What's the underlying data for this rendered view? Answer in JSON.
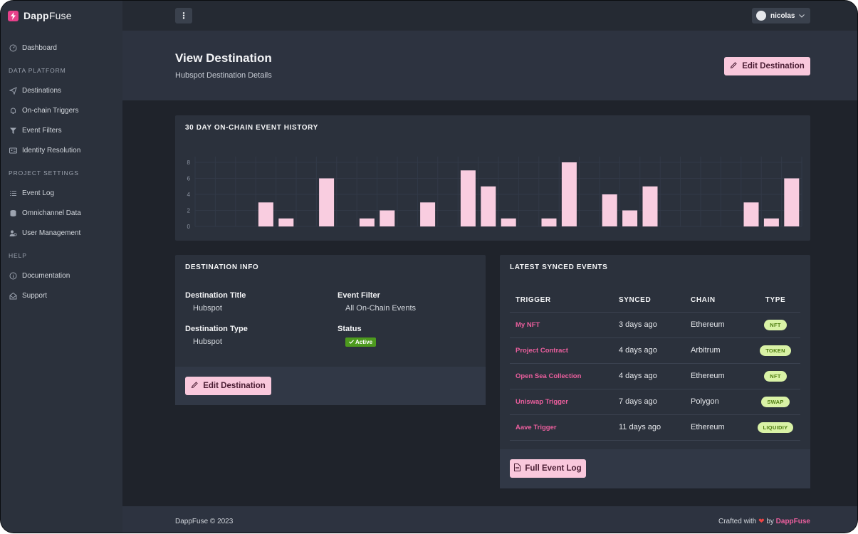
{
  "brand": {
    "name_bold": "Dapp",
    "name_light": "Fuse"
  },
  "sidebar": {
    "dashboard": {
      "label": "Dashboard",
      "icon": "gauge-icon"
    },
    "sections": [
      {
        "title": "DATA PLATFORM",
        "items": [
          {
            "label": "Destinations",
            "icon": "send-icon"
          },
          {
            "label": "On-chain Triggers",
            "icon": "bell-icon"
          },
          {
            "label": "Event Filters",
            "icon": "funnel-icon"
          },
          {
            "label": "Identity Resolution",
            "icon": "id-card-icon"
          }
        ]
      },
      {
        "title": "PROJECT SETTINGS",
        "items": [
          {
            "label": "Event Log",
            "icon": "list-icon"
          },
          {
            "label": "Omnichannel Data",
            "icon": "database-icon"
          },
          {
            "label": "User Management",
            "icon": "users-icon"
          }
        ]
      },
      {
        "title": "HELP",
        "items": [
          {
            "label": "Documentation",
            "icon": "info-icon"
          },
          {
            "label": "Support",
            "icon": "support-icon"
          }
        ]
      }
    ]
  },
  "topbar": {
    "menu_glyph": "⋮",
    "user": "nicolas"
  },
  "header": {
    "title": "View Destination",
    "subtitle": "Hubspot Destination Details",
    "edit_button": "Edit Destination"
  },
  "chart_card": {
    "title": "30 DAY ON-CHAIN EVENT HISTORY"
  },
  "chart_data": {
    "type": "bar",
    "title": "30 DAY ON-CHAIN EVENT HISTORY",
    "values": [
      0,
      0,
      0,
      3,
      1,
      0,
      6,
      0,
      1,
      2,
      0,
      3,
      0,
      7,
      5,
      1,
      0,
      1,
      8,
      0,
      4,
      2,
      5,
      0,
      0,
      0,
      0,
      3,
      1,
      6
    ],
    "ylim": [
      0,
      8
    ],
    "yticks": [
      0,
      2,
      4,
      6,
      8
    ],
    "grid": true,
    "color": "#f9cde0"
  },
  "destination_info": {
    "title": "DESTINATION INFO",
    "dest_title_label": "Destination Title",
    "dest_title_value": "Hubspot",
    "event_filter_label": "Event Filter",
    "event_filter_value": "All On-Chain Events",
    "dest_type_label": "Destination Type",
    "dest_type_value": "Hubspot",
    "status_label": "Status",
    "status_value": "Active",
    "edit_button": "Edit Destination"
  },
  "latest_events": {
    "title": "LATEST SYNCED EVENTS",
    "columns": [
      "TRIGGER",
      "SYNCED",
      "CHAIN",
      "TYPE"
    ],
    "rows": [
      {
        "trigger": "My NFT",
        "synced": "3 days ago",
        "chain": "Ethereum",
        "type": "NFT"
      },
      {
        "trigger": "Project Contract",
        "synced": "4 days ago",
        "chain": "Arbitrum",
        "type": "TOKEN"
      },
      {
        "trigger": "Open Sea Collection",
        "synced": "4 days ago",
        "chain": "Ethereum",
        "type": "NFT"
      },
      {
        "trigger": "Uniswap Trigger",
        "synced": "7 days ago",
        "chain": "Polygon",
        "type": "SWAP"
      },
      {
        "trigger": "Aave Trigger",
        "synced": "11 days ago",
        "chain": "Ethereum",
        "type": "LIQUIDIY"
      }
    ],
    "full_log_button": "Full Event Log"
  },
  "footer": {
    "copyright": "DappFuse © 2023",
    "crafted_prefix": "Crafted with",
    "crafted_by": "by",
    "crafted_brand": "DappFuse"
  },
  "colors": {
    "accent": "#ec5f9e",
    "button_bg": "#f9c8dc",
    "active": "#4d9a1e",
    "type_badge": "#d9f2a6"
  }
}
